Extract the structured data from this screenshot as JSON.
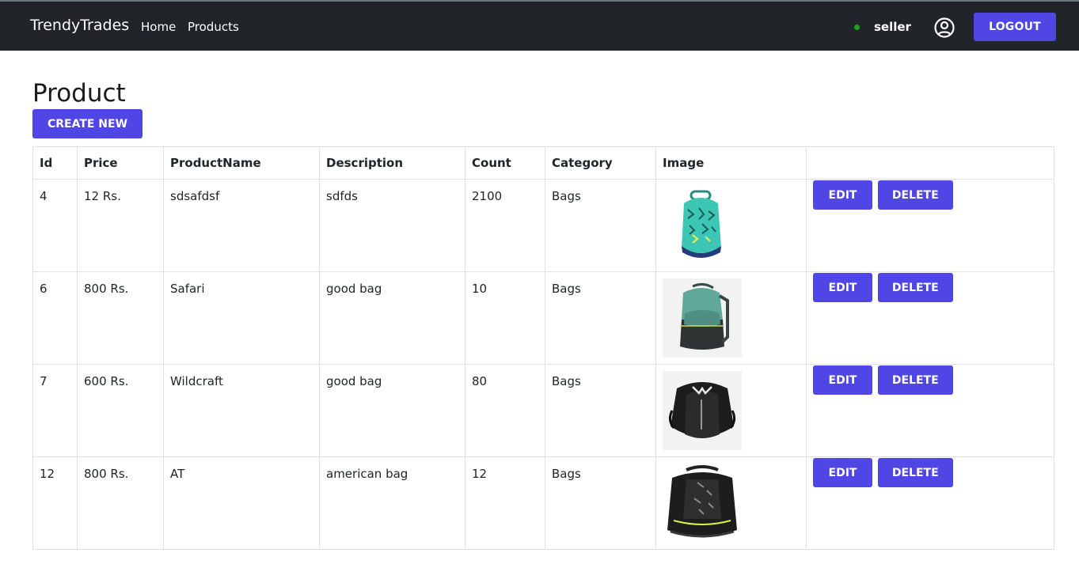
{
  "navbar": {
    "brand": "TrendyTrades",
    "links": [
      "Home",
      "Products"
    ],
    "user": "seller",
    "logout_label": "LOGOUT",
    "status_color": "#1ea21e"
  },
  "page": {
    "title": "Product",
    "create_label": "CREATE NEW"
  },
  "table": {
    "headers": [
      "Id",
      "Price",
      "ProductName",
      "Description",
      "Count",
      "Category",
      "Image",
      ""
    ],
    "rows": [
      {
        "id": "4",
        "price": "12 Rs.",
        "name": "sdsafdsf",
        "description": "sdfds",
        "count": "2100",
        "category": "Bags",
        "image": "teal-patterned-backpack-icon"
      },
      {
        "id": "6",
        "price": "800 Rs.",
        "name": "Safari",
        "description": "good bag",
        "count": "10",
        "category": "Bags",
        "image": "green-grey-backpack-icon"
      },
      {
        "id": "7",
        "price": "600 Rs.",
        "name": "Wildcraft",
        "description": "good bag",
        "count": "80",
        "category": "Bags",
        "image": "black-backpack-icon"
      },
      {
        "id": "12",
        "price": "800 Rs.",
        "name": "AT",
        "description": "american bag",
        "count": "12",
        "category": "Bags",
        "image": "black-printed-backpack-icon"
      }
    ],
    "edit_label": "EDIT",
    "delete_label": "DELETE"
  },
  "colors": {
    "navbar_bg": "#212529",
    "accent": "#4f46e5"
  }
}
